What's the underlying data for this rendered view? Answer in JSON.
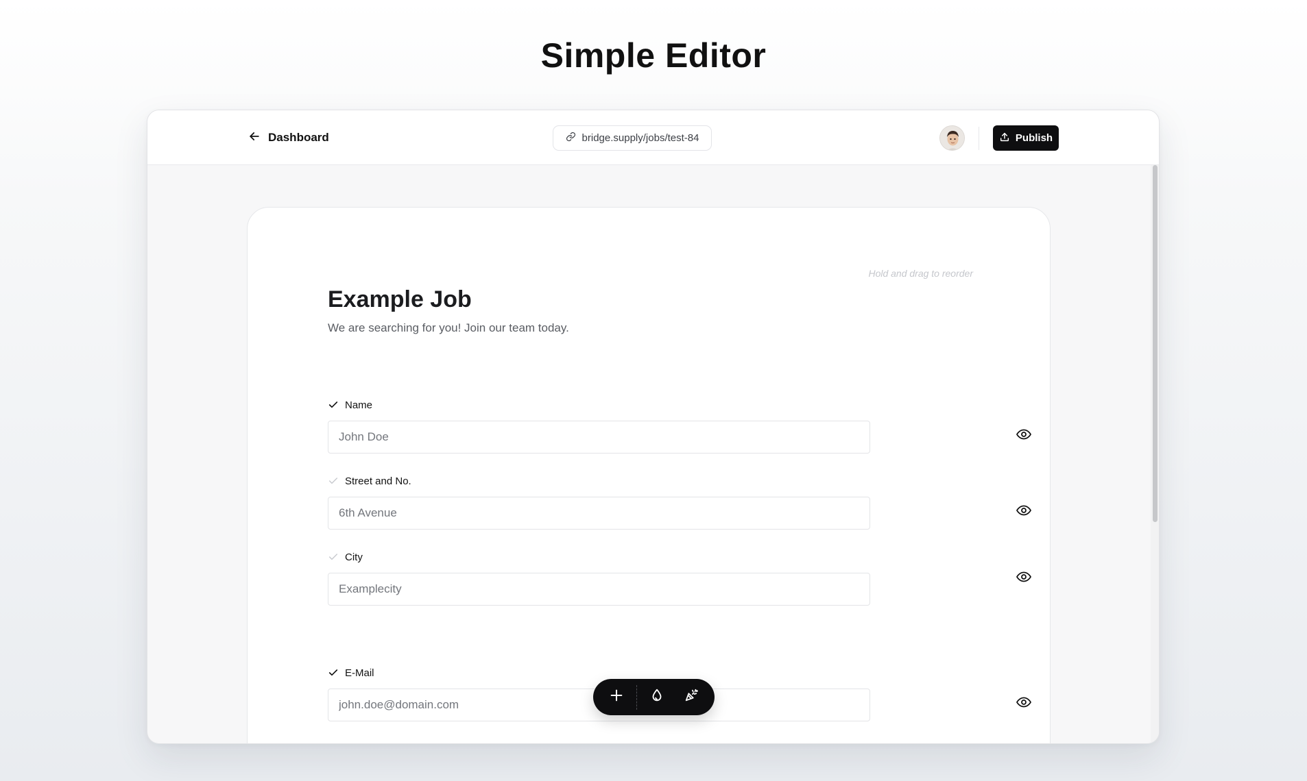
{
  "page": {
    "title": "Simple Editor"
  },
  "topbar": {
    "back_label": "Dashboard",
    "url": "bridge.supply/jobs/test-84",
    "publish_label": "Publish"
  },
  "editor": {
    "drag_hint": "Hold and drag to reorder",
    "job_title": "Example Job",
    "job_description": "We are searching for you! Join our team today.",
    "fields": [
      {
        "label": "Name",
        "placeholder": "John Doe",
        "required": true,
        "visible": true
      },
      {
        "label": "Street and No.",
        "placeholder": "6th Avenue",
        "required": false,
        "visible": true
      },
      {
        "label": "City",
        "placeholder": "Examplecity",
        "required": false,
        "visible": true
      },
      {
        "label": "E-Mail",
        "placeholder": "john.doe@domain.com",
        "required": true,
        "visible": true
      }
    ]
  },
  "toolbar": {
    "buttons": [
      "plus-icon",
      "droplet-icon",
      "party-popper-icon"
    ]
  },
  "colors": {
    "primary": "#0e0e10",
    "check_active": "#111111",
    "check_inactive": "#c8cacf",
    "hint": "#c5c7cc"
  }
}
